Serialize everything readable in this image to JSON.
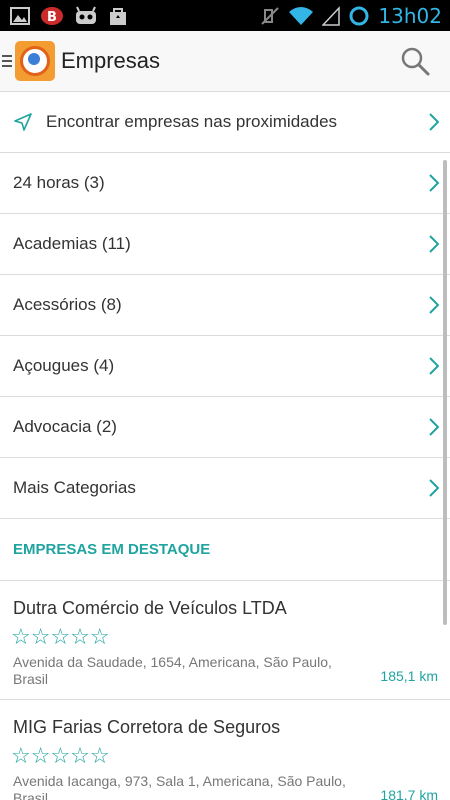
{
  "status_bar": {
    "time": "13h02",
    "left_icons": [
      "gallery-icon",
      "b-app-icon",
      "android-icon",
      "shopping-bag-icon"
    ],
    "right_icons": [
      "mute-icon",
      "wifi-icon",
      "signal-icon",
      "sync-circle-icon"
    ]
  },
  "action_bar": {
    "title": "Empresas",
    "search_icon": "search-icon"
  },
  "nearby": {
    "label": "Encontrar empresas nas proximidades"
  },
  "categories": [
    {
      "label": "24 horas (3)"
    },
    {
      "label": "Academias (11)"
    },
    {
      "label": "Acessórios (8)"
    },
    {
      "label": "Açougues (4)"
    },
    {
      "label": "Advocacia (2)"
    },
    {
      "label": "Mais Categorias"
    }
  ],
  "featured": {
    "title": "EMPRESAS EM DESTAQUE",
    "companies": [
      {
        "name": "Dutra Comércio de Veículos LTDA",
        "stars": "☆☆☆☆☆",
        "rating": 0,
        "address": "Avenida da Saudade, 1654, Americana, São Paulo, Brasil",
        "distance": "185,1 km"
      },
      {
        "name": "MIG Farias Corretora de Seguros",
        "stars": "☆☆☆☆☆",
        "rating": 0,
        "address": "Avenida Iacanga, 973, Sala 1, Americana, São Paulo, Brasil",
        "distance": "181,7 km"
      }
    ]
  },
  "colors": {
    "accent": "#20a4a0",
    "status_time": "#33b5e5",
    "logo": "#f39c32"
  }
}
